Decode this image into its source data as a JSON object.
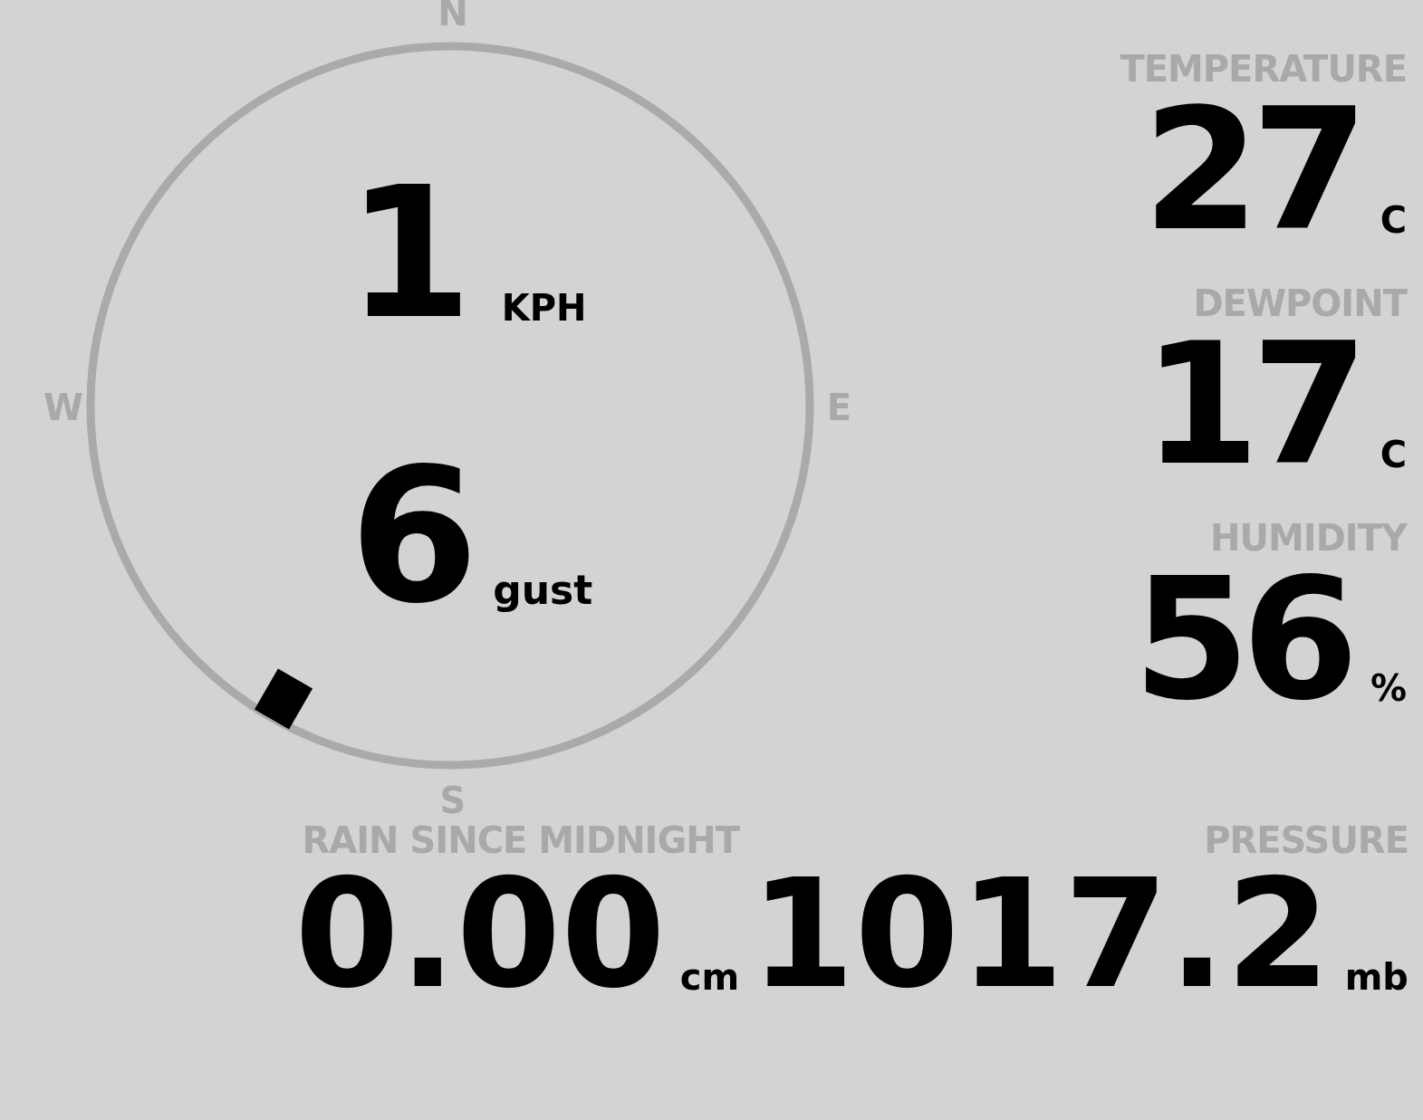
{
  "wind": {
    "compass": [
      "N",
      "E",
      "S",
      "W"
    ],
    "speed": "1",
    "speed_unit": "KPH",
    "gust": "6",
    "gust_unit": "gust"
  },
  "stats": [
    {
      "label": "TEMPERATURE",
      "value": "27",
      "unit": "C"
    },
    {
      "label": "DEWPOINT",
      "value": "17",
      "unit": "C"
    },
    {
      "label": "HUMIDITY",
      "value": "56",
      "unit": "%"
    }
  ],
  "rain": {
    "label": "RAIN SINCE MIDNIGHT",
    "value": "0.00",
    "unit": "cm"
  },
  "pressure": {
    "label": "PRESSURE",
    "value": "1017.2",
    "unit": "mb"
  }
}
